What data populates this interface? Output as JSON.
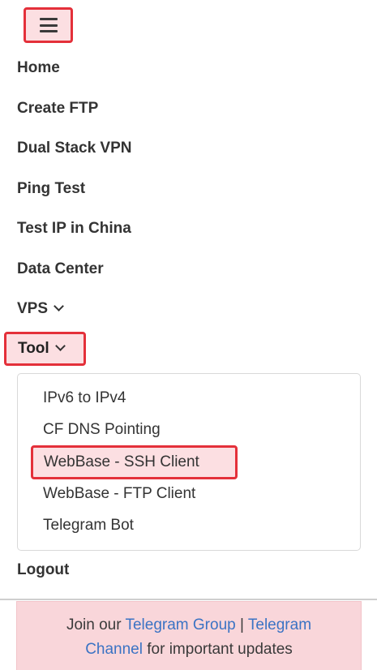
{
  "menu_toggle": {
    "icon": "hamburger-menu-icon"
  },
  "nav": {
    "home": "Home",
    "create_ftp": "Create FTP",
    "dual_stack_vpn": "Dual Stack VPN",
    "ping_test": "Ping Test",
    "test_ip_china": "Test IP in China",
    "data_center": "Data Center",
    "vps": "VPS",
    "tool": "Tool",
    "logout": "Logout"
  },
  "tool_dropdown": {
    "items": [
      "IPv6 to IPv4",
      "CF DNS Pointing",
      "WebBase - SSH Client",
      "WebBase - FTP Client",
      "Telegram Bot"
    ]
  },
  "notice": {
    "prefix": "Join our ",
    "link_group": "Telegram Group",
    "separator": " | ",
    "link_channel_1": "Telegram",
    "link_channel_2": "Channel",
    "suffix": " for important updates"
  },
  "colors": {
    "highlight_border": "#e4303a",
    "highlight_bg": "#fcdfe2",
    "link": "#3b73c4",
    "alert_bg": "#f9d6da"
  }
}
